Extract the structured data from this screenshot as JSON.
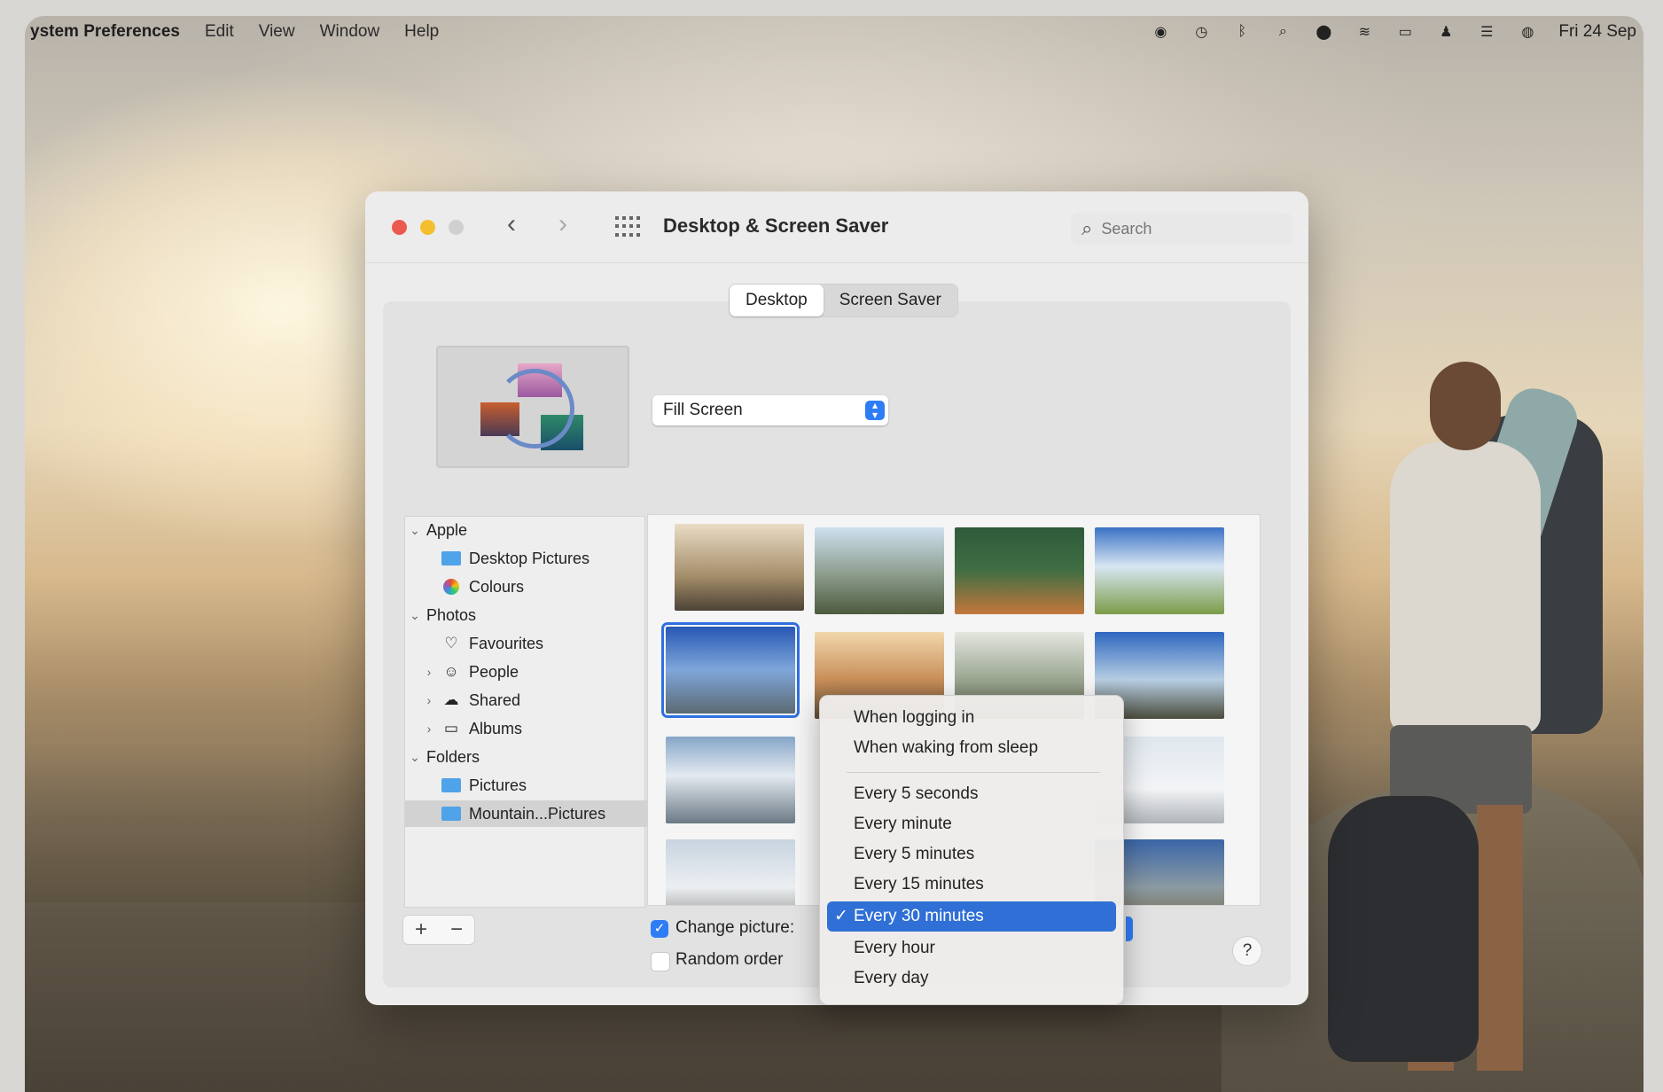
{
  "menubar": {
    "app_name": "ystem Preferences",
    "menus": [
      "Edit",
      "View",
      "Window",
      "Help"
    ],
    "status_icons": [
      "user-circle-icon",
      "clock-icon",
      "bluetooth-icon",
      "search-icon",
      "vpn-icon",
      "wifi-icon",
      "battery-icon",
      "user-icon",
      "control-center-icon",
      "siri-icon"
    ],
    "clock": "Fri 24 Sep"
  },
  "window": {
    "title": "Desktop & Screen Saver",
    "search_placeholder": "Search",
    "tabs": [
      {
        "label": "Desktop",
        "active": true
      },
      {
        "label": "Screen Saver",
        "active": false
      }
    ],
    "fill_mode": "Fill Screen",
    "sidebar": [
      {
        "label": "Apple",
        "level": 0,
        "expanded": true,
        "icon": "none"
      },
      {
        "label": "Desktop Pictures",
        "level": 1,
        "icon": "folder-icon"
      },
      {
        "label": "Colours",
        "level": 1,
        "icon": "colour-wheel-icon"
      },
      {
        "label": "Photos",
        "level": 0,
        "expanded": true,
        "icon": "none"
      },
      {
        "label": "Favourites",
        "level": 1,
        "icon": "heart-icon"
      },
      {
        "label": "People",
        "level": 1,
        "icon": "person-icon",
        "collapsed": true
      },
      {
        "label": "Shared",
        "level": 1,
        "icon": "cloud-icon",
        "collapsed": true
      },
      {
        "label": "Albums",
        "level": 1,
        "icon": "album-icon",
        "collapsed": true
      },
      {
        "label": "Folders",
        "level": 0,
        "expanded": true,
        "icon": "none"
      },
      {
        "label": "Pictures",
        "level": 1,
        "icon": "folder-icon"
      },
      {
        "label": "Mountain...Pictures",
        "level": 1,
        "icon": "folder-icon",
        "selected": true
      }
    ],
    "add_label": "+",
    "remove_label": "−",
    "change_picture_label": "Change picture:",
    "change_picture_checked": true,
    "random_order_label": "Random order",
    "random_order_checked": false,
    "help_label": "?"
  },
  "dropdown": {
    "items": [
      {
        "label": "When logging in",
        "checked": false
      },
      {
        "label": "When waking from sleep",
        "checked": false
      },
      {
        "label": "Every 5 seconds",
        "checked": false
      },
      {
        "label": "Every minute",
        "checked": false
      },
      {
        "label": "Every 5 minutes",
        "checked": false
      },
      {
        "label": "Every 15 minutes",
        "checked": false
      },
      {
        "label": "Every 30 minutes",
        "checked": true
      },
      {
        "label": "Every hour",
        "checked": false
      },
      {
        "label": "Every day",
        "checked": false
      }
    ],
    "check_glyph": "✓"
  },
  "colors": {
    "accent": "#2f7df6",
    "close": "#ec5a4f",
    "minimize": "#f4bf2e",
    "zoom_disabled": "#d0d0d0"
  }
}
